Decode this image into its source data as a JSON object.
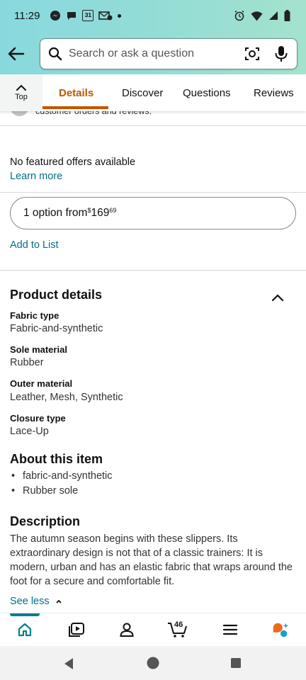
{
  "status_bar": {
    "time": "11:29",
    "calendar_day": "31"
  },
  "search": {
    "placeholder": "Search or ask a question"
  },
  "tabs": {
    "top_label": "Top",
    "items": [
      {
        "label": "Details",
        "active": true
      },
      {
        "label": "Discover",
        "active": false
      },
      {
        "label": "Questions",
        "active": false
      },
      {
        "label": "Reviews",
        "active": false
      }
    ]
  },
  "partial_row": {
    "text": "customer orders and reviews."
  },
  "offers": {
    "no_offers": "No featured offers available",
    "learn_more": "Learn more",
    "option_prefix": "1 option from ",
    "currency": "$",
    "price_whole": "169",
    "price_fraction": "69",
    "add_to_list": "Add to List"
  },
  "product_details": {
    "title": "Product details",
    "rows": [
      {
        "label": "Fabric type",
        "value": "Fabric-and-synthetic"
      },
      {
        "label": "Sole material",
        "value": "Rubber"
      },
      {
        "label": "Outer material",
        "value": "Leather, Mesh, Synthetic"
      },
      {
        "label": "Closure type",
        "value": "Lace-Up"
      }
    ]
  },
  "about": {
    "title": "About this item",
    "bullets": [
      "fabric-and-synthetic",
      "Rubber sole"
    ]
  },
  "description": {
    "title": "Description",
    "text": "The autumn season begins with these slippers. Its extraordinary design is not that of a classic trainers: It is modern, urban and has an elastic fabric that wraps around the foot for a secure and comfortable fit.",
    "see_less": "See less"
  },
  "bottom_nav": {
    "cart_count": "46",
    "items": [
      "home-icon",
      "video-icon",
      "account-icon",
      "cart-icon",
      "menu-icon",
      "rufus-icon"
    ],
    "accent": "#0a7e8c"
  },
  "colors": {
    "header_gradient_start": "#88d9de",
    "header_gradient_end": "#a3e2cd",
    "active_tab": "#c45500",
    "link": "#007185"
  }
}
